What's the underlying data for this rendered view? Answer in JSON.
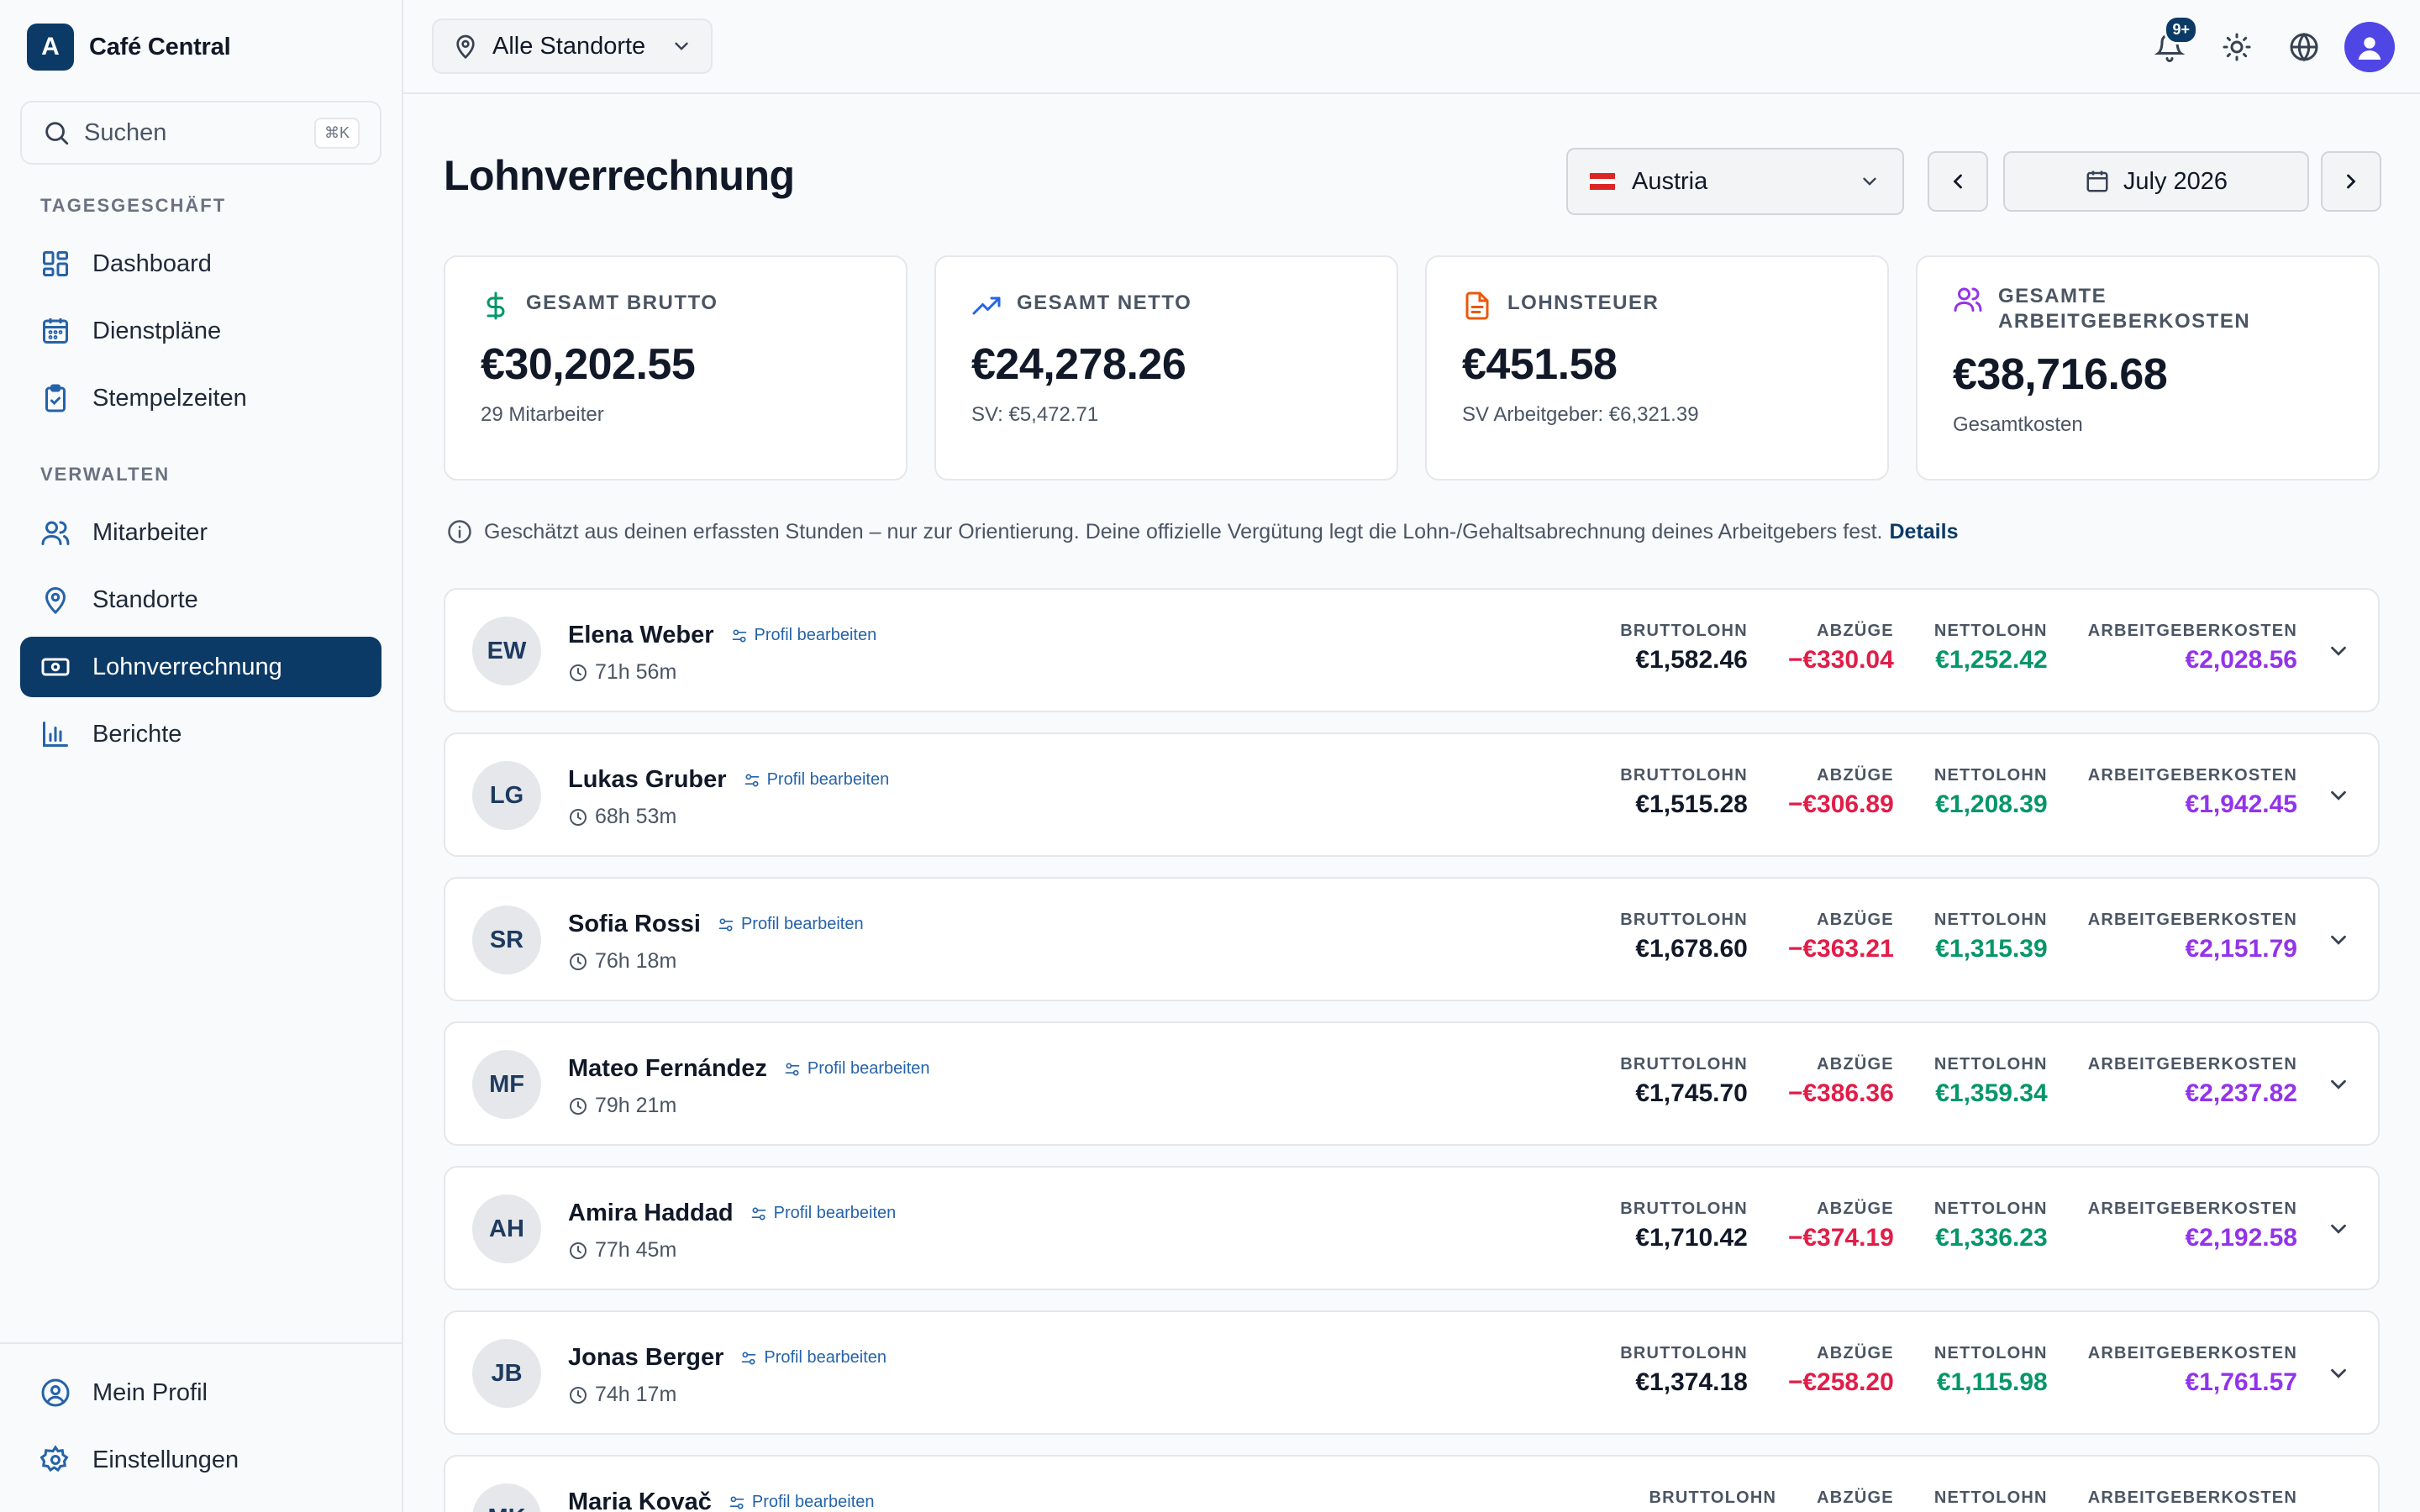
{
  "brand": {
    "initial": "A",
    "name": "Café Central"
  },
  "search": {
    "placeholder": "Suchen",
    "shortcut": "⌘K"
  },
  "sidebar": {
    "section_daily": "TAGESGESCHÄFT",
    "section_manage": "VERWALTEN",
    "items": [
      {
        "label": "Dashboard",
        "icon": "dashboard-icon"
      },
      {
        "label": "Dienstpläne",
        "icon": "calendar-icon"
      },
      {
        "label": "Stempelzeiten",
        "icon": "clipboard-check-icon"
      },
      {
        "label": "Mitarbeiter",
        "icon": "users-icon"
      },
      {
        "label": "Standorte",
        "icon": "map-pin-icon"
      },
      {
        "label": "Lohnverrechnung",
        "icon": "banknote-icon",
        "active": true
      },
      {
        "label": "Berichte",
        "icon": "bar-chart-icon"
      }
    ],
    "bottom": [
      {
        "label": "Mein Profil",
        "icon": "user-circle-icon"
      },
      {
        "label": "Einstellungen",
        "icon": "gear-icon"
      }
    ]
  },
  "topbar": {
    "location": "Alle Standorte",
    "notifications_badge": "9+"
  },
  "page": {
    "title": "Lohnverrechnung"
  },
  "filters": {
    "country": "Austria",
    "month": "July 2026"
  },
  "stats": [
    {
      "label": "GESAMT BRUTTO",
      "value": "€30,202.55",
      "sub": "29 Mitarbeiter",
      "color": "#059669",
      "icon": "dollar-icon"
    },
    {
      "label": "GESAMT NETTO",
      "value": "€24,278.26",
      "sub": "SV: €5,472.71",
      "color": "#2563eb",
      "icon": "trending-up-icon"
    },
    {
      "label": "LOHNSTEUER",
      "value": "€451.58",
      "sub": "SV Arbeitgeber: €6,321.39",
      "color": "#ea580c",
      "icon": "file-text-icon"
    },
    {
      "label": "GESAMTE ARBEITGEBERKOSTEN",
      "label_line1": "GESAMTE",
      "label_line2": "ARBEITGEBERKOSTEN",
      "value": "€38,716.68",
      "sub": "Gesamtkosten",
      "color": "#9333ea",
      "icon": "users-icon"
    }
  ],
  "info": {
    "text": "Geschätzt aus deinen erfassten Stunden – nur zur Orientierung. Deine offizielle Vergütung legt die Lohn-/Gehaltsabrechnung deines Arbeitgebers fest.",
    "link": "Details"
  },
  "columns": {
    "gross": "BRUTTOLOHN",
    "deductions": "ABZÜGE",
    "net": "NETTOLOHN",
    "employer": "ARBEITGEBERKOSTEN"
  },
  "edit_label": "Profil bearbeiten",
  "employees": [
    {
      "initials": "EW",
      "name": "Elena Weber",
      "hours": "71h 56m",
      "gross": "€1,582.46",
      "deductions": "−€330.04",
      "net": "€1,252.42",
      "employer": "€2,028.56"
    },
    {
      "initials": "LG",
      "name": "Lukas Gruber",
      "hours": "68h 53m",
      "gross": "€1,515.28",
      "deductions": "−€306.89",
      "net": "€1,208.39",
      "employer": "€1,942.45"
    },
    {
      "initials": "SR",
      "name": "Sofia Rossi",
      "hours": "76h 18m",
      "gross": "€1,678.60",
      "deductions": "−€363.21",
      "net": "€1,315.39",
      "employer": "€2,151.79"
    },
    {
      "initials": "MF",
      "name": "Mateo Fernández",
      "hours": "79h 21m",
      "gross": "€1,745.70",
      "deductions": "−€386.36",
      "net": "€1,359.34",
      "employer": "€2,237.82"
    },
    {
      "initials": "AH",
      "name": "Amira Haddad",
      "hours": "77h 45m",
      "gross": "€1,710.42",
      "deductions": "−€374.19",
      "net": "€1,336.23",
      "employer": "€2,192.58"
    },
    {
      "initials": "JB",
      "name": "Jonas Berger",
      "hours": "74h 17m",
      "gross": "€1,374.18",
      "deductions": "−€258.20",
      "net": "€1,115.98",
      "employer": "€1,761.57"
    },
    {
      "initials": "MK",
      "name": "Maria Kovač",
      "hours": "",
      "gross": "",
      "deductions": "",
      "net": "",
      "employer": ""
    }
  ],
  "colors": {
    "primary": "#0b3a66",
    "deduction": "#e11d48",
    "net": "#059669",
    "employer_cost": "#9333ea"
  }
}
